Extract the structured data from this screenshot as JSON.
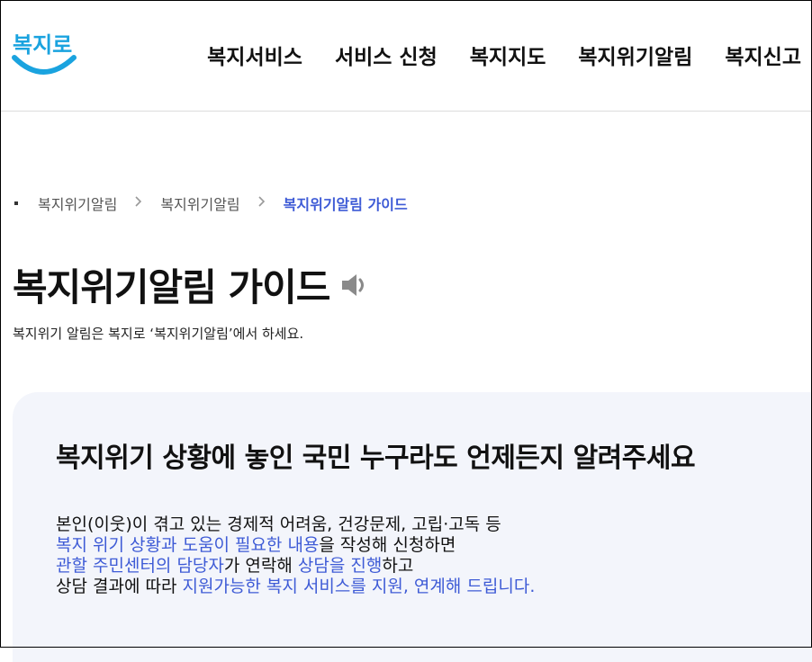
{
  "header": {
    "logo_text": "복지로",
    "nav": [
      {
        "label": "복지서비스"
      },
      {
        "label": "서비스 신청"
      },
      {
        "label": "복지지도"
      },
      {
        "label": "복지위기알림"
      },
      {
        "label": "복지신고"
      }
    ]
  },
  "breadcrumb": {
    "items": [
      "복지위기알림",
      "복지위기알림"
    ],
    "current": "복지위기알림 가이드"
  },
  "page": {
    "title": "복지위기알림 가이드",
    "subtitle": "복지위기 알림은 복지로 ‘복지위기알림’에서 하세요."
  },
  "info": {
    "heading": "복지위기 상황에 놓인 국민 누구라도 언제든지 알려주세요",
    "line1": "본인(이웃)이 겪고 있는 경제적 어려움, 건강문제, 고립·고독 등",
    "line2_hl": "복지 위기 상황과 도움이 필요한 내용",
    "line2_rest": "을 작성해 신청하면",
    "line3_hl1": "관할 주민센터의 담당자",
    "line3_mid": "가 연락해 ",
    "line3_hl2": "상담을 진행",
    "line3_rest": "하고",
    "line4_pre": "상담 결과에 따라 ",
    "line4_hl": "지원가능한 복지 서비스를 지원, 연계해 드립니다."
  },
  "colors": {
    "accent": "#3e5bd6",
    "logo": "#1aa3df",
    "box_bg": "#f3f5fb"
  },
  "icons": {
    "speaker": "speaker-icon",
    "chevron": "chevron-right-icon"
  }
}
